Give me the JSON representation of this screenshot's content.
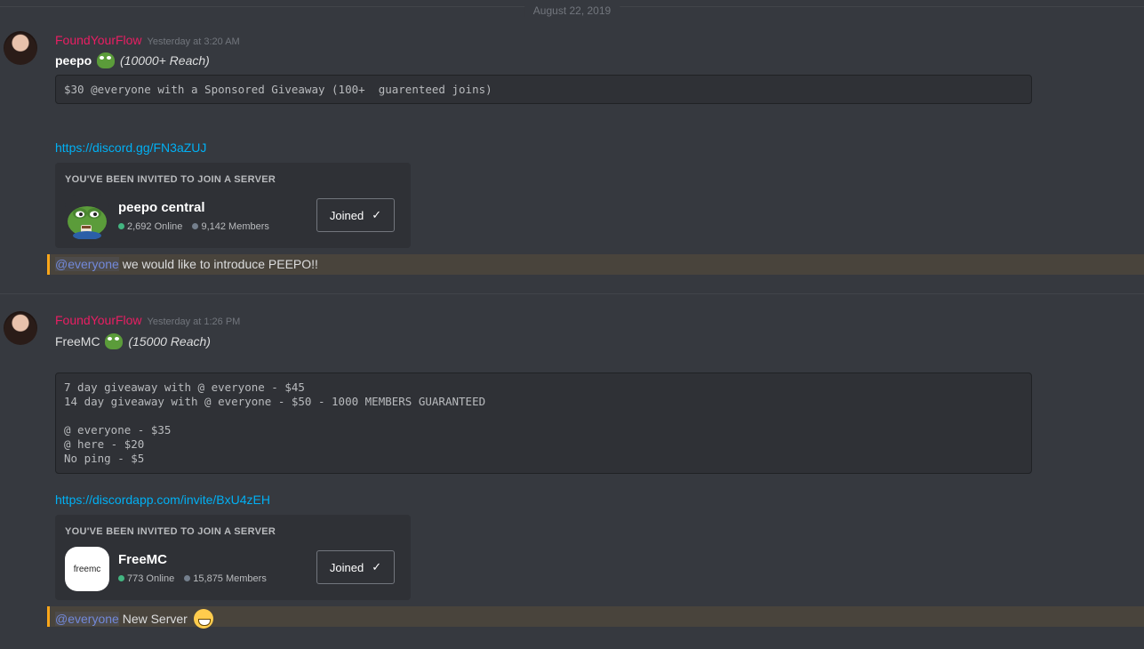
{
  "date_divider": "August 22, 2019",
  "messages": [
    {
      "author": "FoundYourFlow",
      "timestamp": "Yesterday at 3:20 AM",
      "title_bold": "peepo",
      "reach": "(10000+ Reach)",
      "code": "$30 @everyone with a Sponsored Giveaway (100+  guarenteed joins)",
      "link": "https://discord.gg/FN3aZUJ",
      "invite": {
        "header": "YOU'VE BEEN INVITED TO JOIN A SERVER",
        "server_name": "peepo central",
        "online": "2,692 Online",
        "members": "9,142 Members",
        "button": "Joined"
      },
      "mention": "@everyone",
      "mention_text": " we would like to introduce PEEPO!!"
    },
    {
      "author": "FoundYourFlow",
      "timestamp": "Yesterday at 1:26 PM",
      "title": "FreeMC",
      "reach": "(15000 Reach)",
      "code": "7 day giveaway with @ everyone - $45\n14 day giveaway with @ everyone - $50 - 1000 MEMBERS GUARANTEED\n\n@ everyone - $35\n@ here - $20\nNo ping - $5",
      "link": "https://discordapp.com/invite/BxU4zEH",
      "invite": {
        "header": "YOU'VE BEEN INVITED TO JOIN A SERVER",
        "server_name": "FreeMC",
        "icon_text": "freemc",
        "online": "773 Online",
        "members": "15,875 Members",
        "button": "Joined"
      },
      "mention": "@everyone",
      "mention_text": " New Server"
    }
  ],
  "icons": {
    "check": "check-icon",
    "peepo": "peepo-emoji",
    "grin": "grinning-emoji"
  },
  "colors": {
    "background": "#36393f",
    "author": "#e91e63",
    "link": "#00b0f4",
    "mention": "#7289da",
    "mention_highlight": "#faa61a",
    "online": "#43b581"
  }
}
